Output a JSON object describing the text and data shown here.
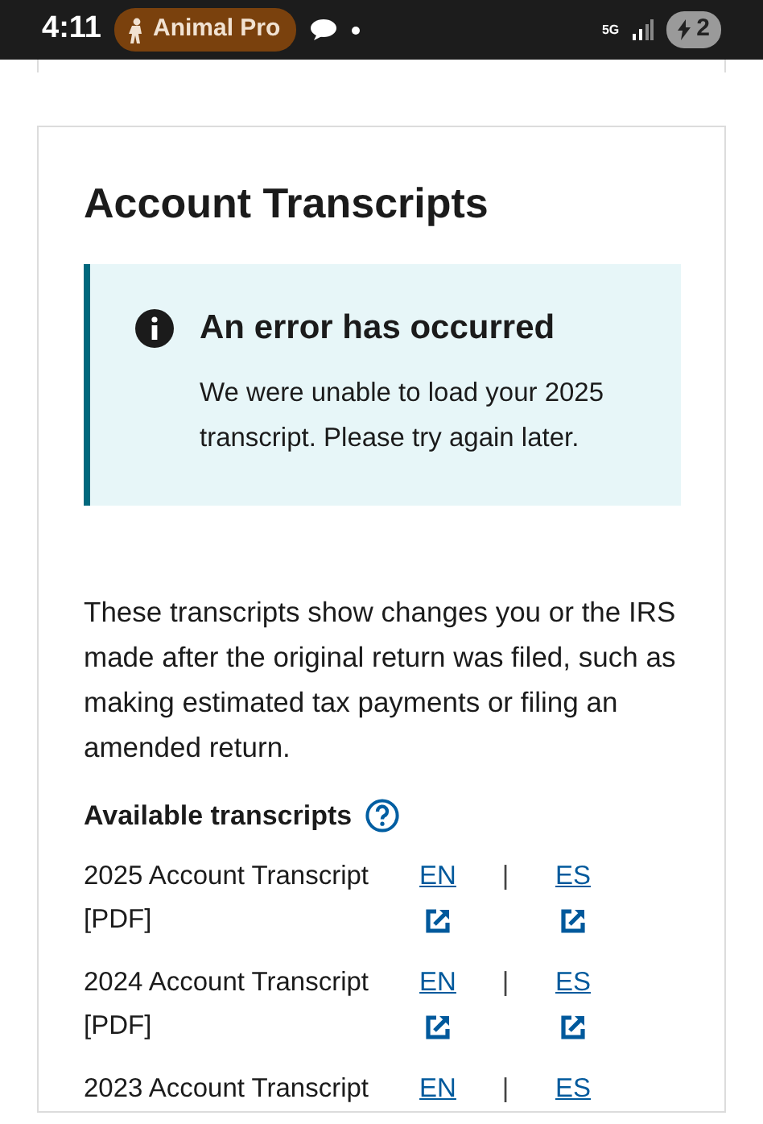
{
  "status_bar": {
    "time": "4:11",
    "app_pill": "Animal Pro",
    "network": "5G",
    "battery": "2"
  },
  "card": {
    "title": "Account Transcripts",
    "alert": {
      "heading": "An error has occurred",
      "body": "We were unable to load your 2025 transcript. Please try again later."
    },
    "intro": "These transcripts show changes you or the IRS made after the original return was filed, such as making estimated tax payments or filing an amended return.",
    "section_heading": "Available transcripts",
    "transcripts": [
      {
        "label": "2025 Account Transcript",
        "format": "[PDF]",
        "links": [
          "EN",
          "ES"
        ],
        "separator": "|"
      },
      {
        "label": "2024 Account Transcript",
        "format": "[PDF]",
        "links": [
          "EN",
          "ES"
        ],
        "separator": "|"
      },
      {
        "label": "2023 Account Transcript",
        "links": [
          "EN",
          "ES"
        ],
        "separator": "|"
      }
    ]
  }
}
